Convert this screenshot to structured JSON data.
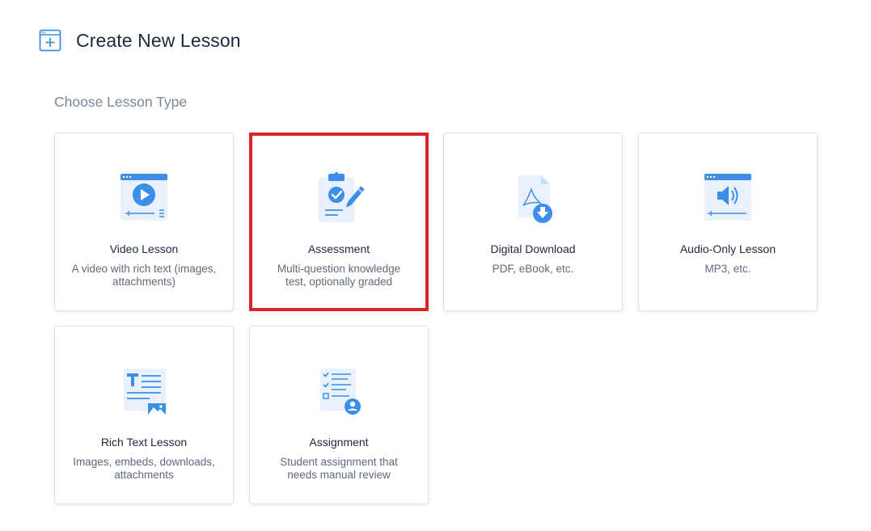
{
  "page": {
    "title": "Create New Lesson",
    "subtitle": "Choose Lesson Type"
  },
  "lesson_types": [
    {
      "name": "Video Lesson",
      "description": "A video with rich text (images, attachments)",
      "icon": "video-player-icon"
    },
    {
      "name": "Assessment",
      "description": "Multi-question knowledge test, optionally graded",
      "icon": "clipboard-check-icon",
      "highlighted": true
    },
    {
      "name": "Digital Download",
      "description": "PDF, eBook, etc.",
      "icon": "pdf-download-icon"
    },
    {
      "name": "Audio-Only Lesson",
      "description": "MP3, etc.",
      "icon": "audio-player-icon"
    },
    {
      "name": "Rich Text Lesson",
      "description": "Images, embeds, downloads, attachments",
      "icon": "rich-text-icon"
    },
    {
      "name": "Assignment",
      "description": "Student assignment that needs manual review",
      "icon": "assignment-checklist-icon"
    }
  ],
  "colors": {
    "accent": "#3d8ee8",
    "accent_light": "#e8f1fc",
    "highlight_border": "#d92329",
    "title_text": "#1c2a3e",
    "muted_text": "#7a8796"
  }
}
